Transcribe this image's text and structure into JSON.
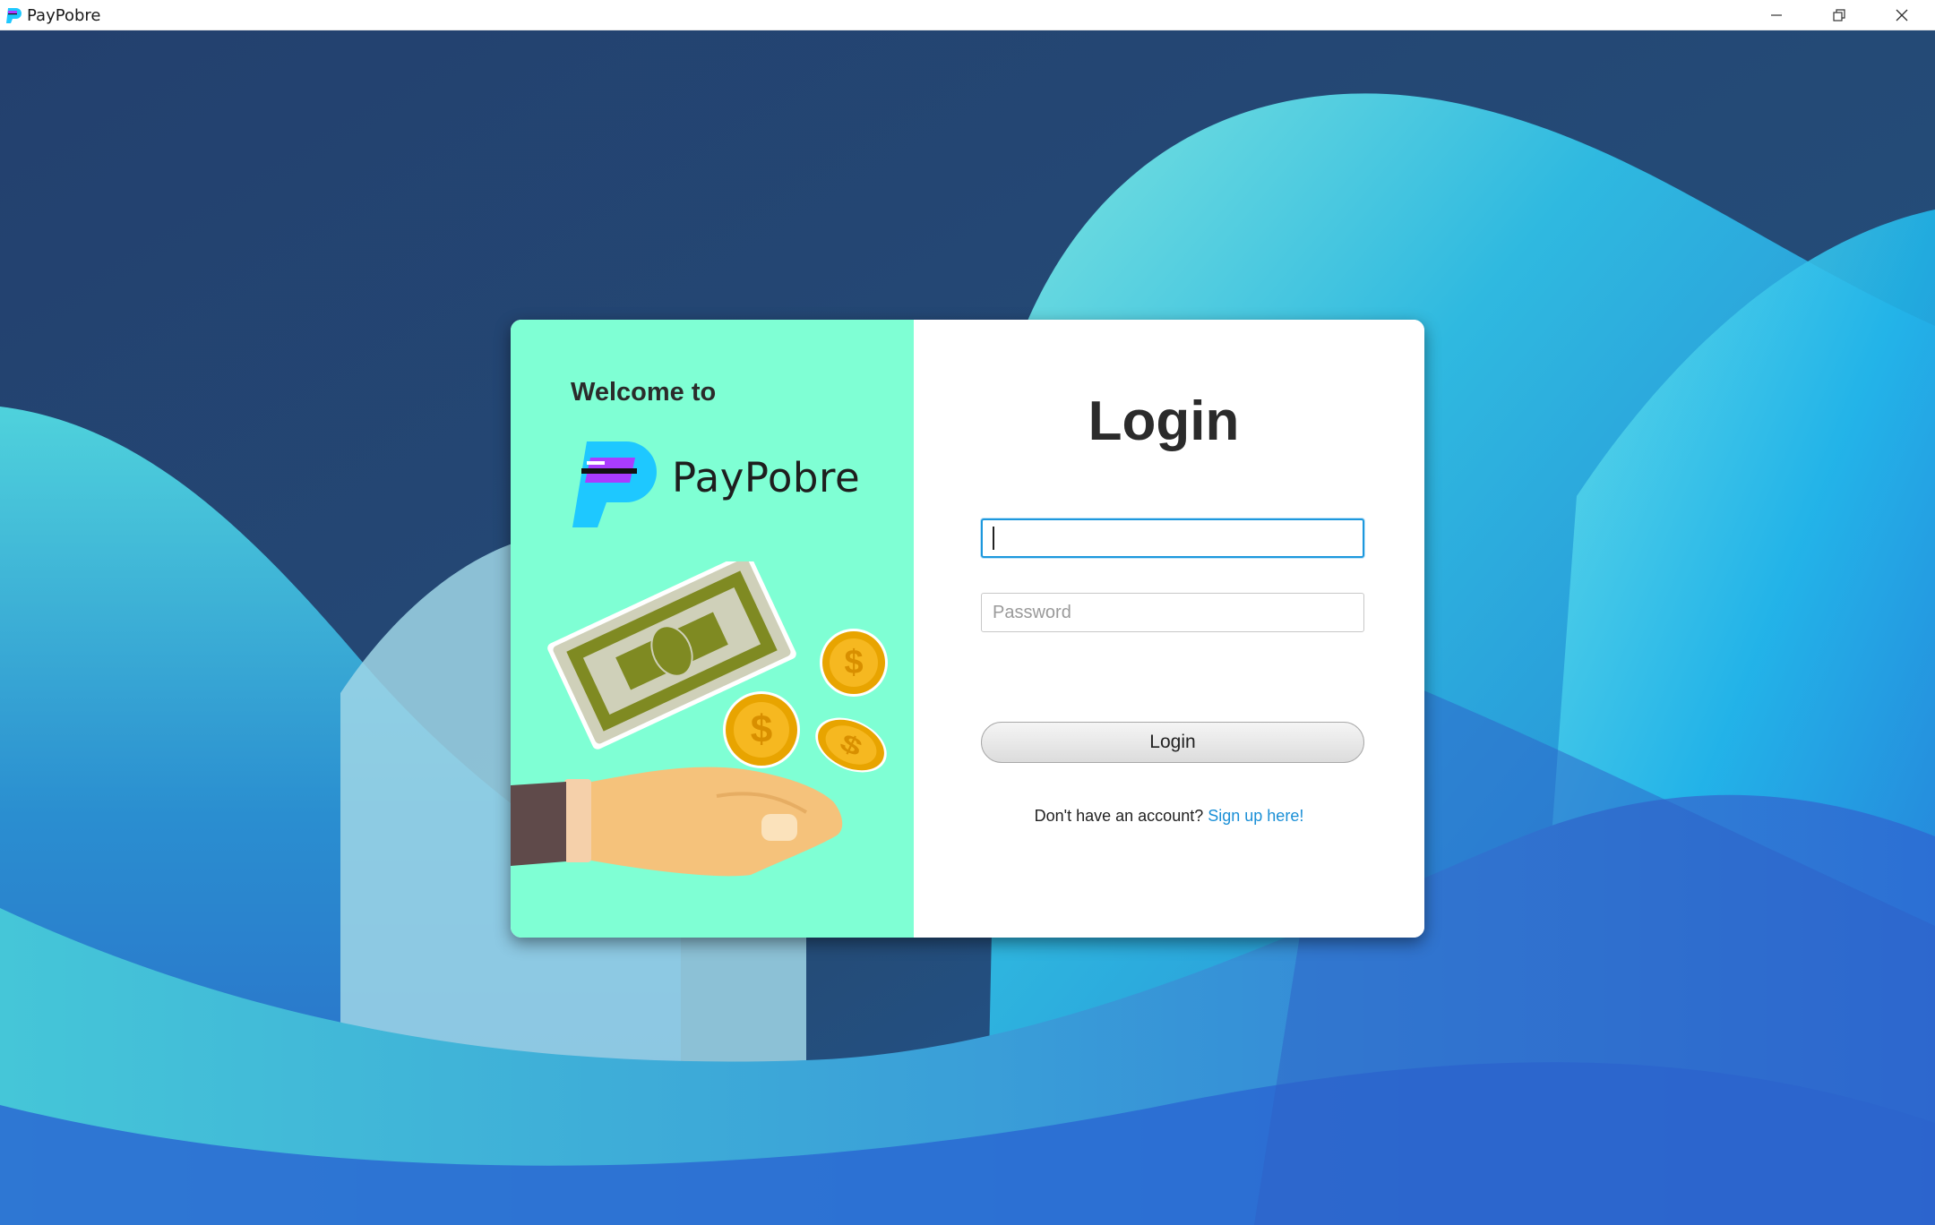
{
  "window": {
    "title": "PayPobre"
  },
  "welcome": {
    "heading": "Welcome to",
    "brand_name": "PayPobre"
  },
  "login": {
    "title": "Login",
    "username": {
      "value": "",
      "placeholder": ""
    },
    "password": {
      "value": "",
      "placeholder": "Password"
    },
    "submit_label": "Login",
    "signup_prompt": "Don't have an account?",
    "signup_link": "Sign up here!"
  },
  "icons": {
    "app": "paypobre-logo-icon",
    "minimize": "minimize-icon",
    "maximize": "restore-icon",
    "close": "close-icon"
  },
  "colors": {
    "accent": "#1d98dd",
    "link": "#1a8fd6",
    "left_panel": "#7fffd4",
    "logo_blue": "#1ec8ff",
    "logo_purple": "#a93cff"
  }
}
